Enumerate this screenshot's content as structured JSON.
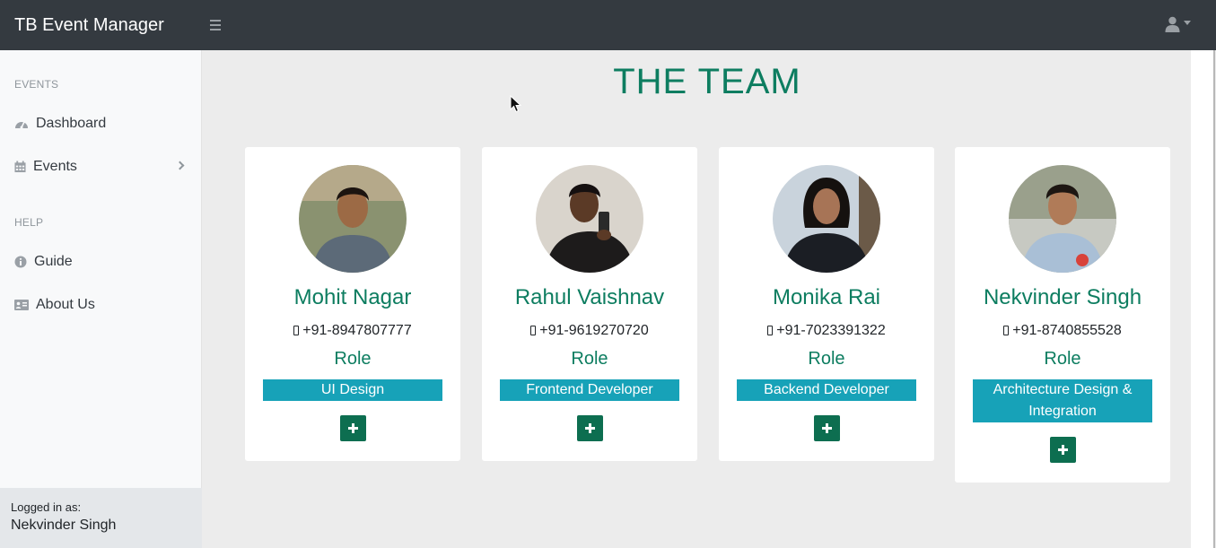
{
  "app": {
    "title": "TB Event Manager"
  },
  "sidebar": {
    "sections": [
      {
        "heading": "EVENTS"
      },
      {
        "heading": "HELP"
      }
    ],
    "items": [
      {
        "label": "Dashboard",
        "icon": "dashboard-gauge-icon"
      },
      {
        "label": "Events",
        "icon": "calendar-icon"
      },
      {
        "label": "Guide",
        "icon": "info-circle-icon"
      },
      {
        "label": "About Us",
        "icon": "id-card-icon"
      }
    ],
    "footer": {
      "logged_in_label": "Logged in as:",
      "user_name": "Nekvinder Singh"
    }
  },
  "main": {
    "title": "THE TEAM",
    "members": [
      {
        "name": "Mohit Nagar",
        "phone": "+91-8947807777",
        "role_label": "Role",
        "role": "UI Design"
      },
      {
        "name": "Rahul Vaishnav",
        "phone": "+91-9619270720",
        "role_label": "Role",
        "role": "Frontend Developer"
      },
      {
        "name": "Monika Rai",
        "phone": "+91-7023391322",
        "role_label": "Role",
        "role": "Backend Developer"
      },
      {
        "name": "Nekvinder Singh",
        "phone": "+91-8740855528",
        "role_label": "Role",
        "role": "Architecture Design & Integration"
      }
    ]
  },
  "colors": {
    "topbar": "#343a40",
    "accent_green": "#0d7d60",
    "button_green": "#0d6e50",
    "role_badge": "#17a2b8",
    "sidebar_bg": "#f8f9fa",
    "content_bg": "#ececec"
  }
}
